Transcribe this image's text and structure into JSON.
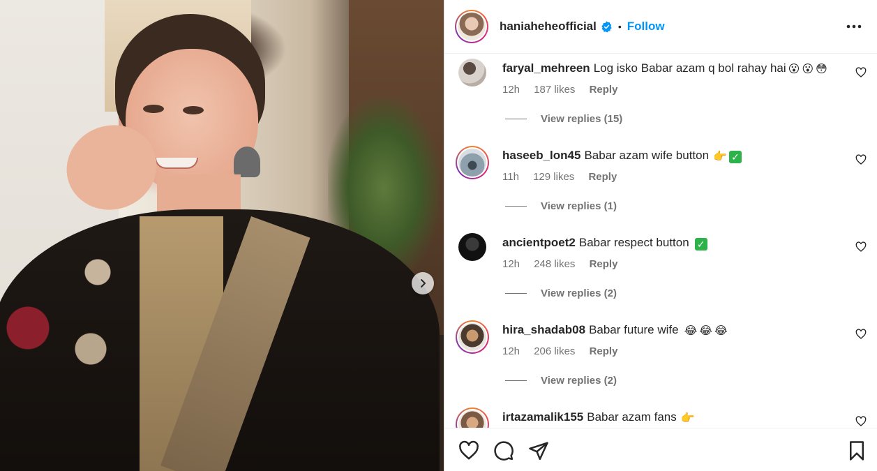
{
  "post": {
    "username": "haniaheheofficial",
    "follow_label": "Follow",
    "separator": "•"
  },
  "comments": [
    {
      "username": "faryal_mehreen",
      "text": "Log isko Babar azam q bol rahay hai",
      "emojis": [
        "😮",
        "😮",
        "😳"
      ],
      "time": "12h",
      "likes": "187 likes",
      "reply_label": "Reply",
      "view_replies": "View replies (15)",
      "has_story": false
    },
    {
      "username": "haseeb_lon45",
      "text": "Babar azam wife button",
      "emojis": [
        "👉",
        "✅"
      ],
      "time": "11h",
      "likes": "129 likes",
      "reply_label": "Reply",
      "view_replies": "View replies (1)",
      "has_story": true
    },
    {
      "username": "ancientpoet2",
      "text": "Babar respect button",
      "emojis": [
        "✅"
      ],
      "time": "12h",
      "likes": "248 likes",
      "reply_label": "Reply",
      "view_replies": "View replies (2)",
      "has_story": false
    },
    {
      "username": "hira_shadab08",
      "text": "Babar future wife",
      "emojis": [
        "😂",
        "😂",
        "😂"
      ],
      "time": "12h",
      "likes": "206 likes",
      "reply_label": "Reply",
      "view_replies": "View replies (2)",
      "has_story": true
    },
    {
      "username": "irtazamalik155",
      "text": "Babar azam fans",
      "emojis": [
        "👉"
      ],
      "has_story": true
    }
  ],
  "colors": {
    "accent": "#0095f6",
    "text": "#262626",
    "secondary": "#737373",
    "verified": "#0095f6"
  },
  "icons": {
    "verified": "verified-badge-icon",
    "more": "more-options-icon",
    "like": "heart-icon",
    "comment": "comment-icon",
    "share": "share-icon",
    "save": "bookmark-icon",
    "next": "chevron-right-icon"
  }
}
